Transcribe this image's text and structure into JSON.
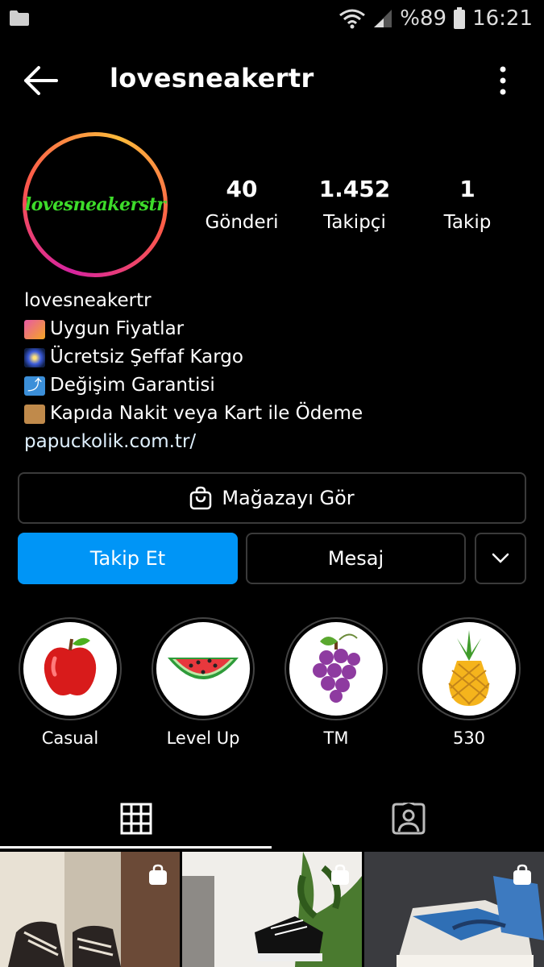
{
  "status_bar": {
    "battery_text": "%89",
    "time": "16:21"
  },
  "header": {
    "username": "lovesneakertr"
  },
  "profile": {
    "avatar_text": "lovesneakerstr",
    "stats": [
      {
        "value": "40",
        "label": "Gönderi"
      },
      {
        "value": "1.452",
        "label": "Takipçi"
      },
      {
        "value": "1",
        "label": "Takip"
      }
    ]
  },
  "bio": {
    "name": "lovesneakertr",
    "lines": [
      {
        "emoji": "shopping-bags-icon",
        "text": "Uygun Fiyatlar"
      },
      {
        "emoji": "fireworks-icon",
        "text": "Ücretsiz Şeffaf Kargo"
      },
      {
        "emoji": "return-arrow-icon",
        "text": "Değişim Garantisi"
      },
      {
        "emoji": "package-icon",
        "text": "Kapıda Nakit veya Kart ile Ödeme"
      }
    ],
    "link": "papuckolik.com.tr/"
  },
  "buttons": {
    "shop": "Mağazayı Gör",
    "follow": "Takip Et",
    "message": "Mesaj"
  },
  "highlights": [
    {
      "label": "Casual",
      "icon": "apple-icon"
    },
    {
      "label": "Level Up",
      "icon": "watermelon-icon"
    },
    {
      "label": "TM",
      "icon": "grapes-icon"
    },
    {
      "label": "530",
      "icon": "pineapple-icon"
    }
  ],
  "colors": {
    "follow_button": "#0095f6",
    "avatar_text": "#3ddc2a",
    "background": "#000000"
  }
}
